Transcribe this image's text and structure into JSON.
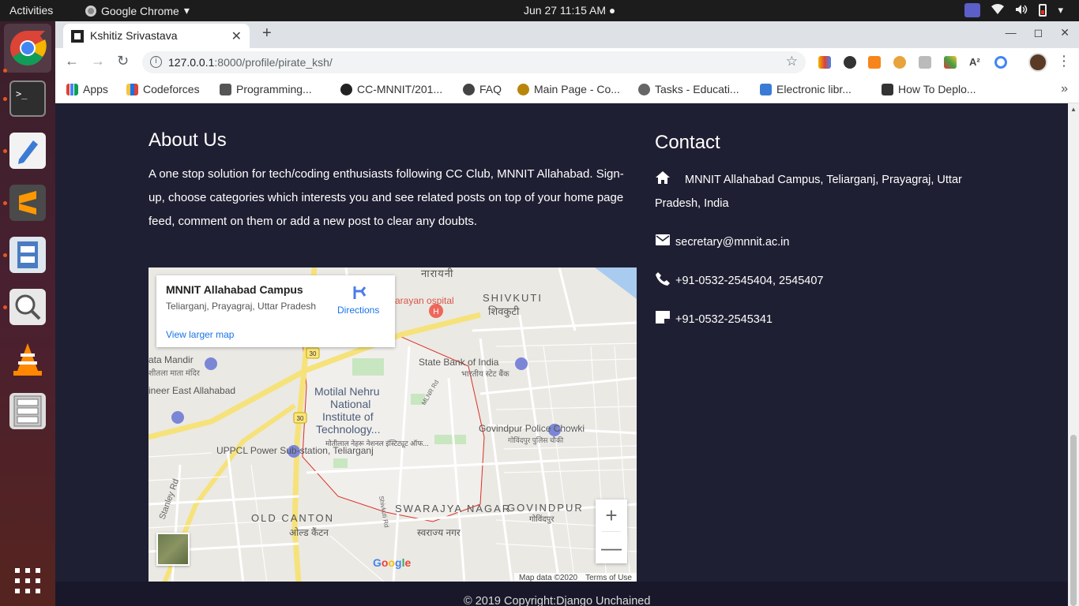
{
  "topbar": {
    "activities": "Activities",
    "app_name": "Google Chrome",
    "app_arrow": "▾",
    "clock": "Jun 27  11:15 AM ●"
  },
  "dock": {
    "items": [
      "chrome",
      "terminal",
      "text-editor",
      "sublime-text",
      "file-manager",
      "search",
      "vlc",
      "file-cabinet",
      "app-grid"
    ]
  },
  "browser": {
    "tab_title": "Kshitiz Srivastava",
    "tab_close": "✕",
    "new_tab": "+",
    "window_controls": [
      "—",
      "◻",
      "✕"
    ],
    "url_host": "127.0.0.1",
    "url_path": ":8000/profile/pirate_ksh/",
    "bookmarks": [
      {
        "label": "Apps",
        "color": "#4285f4"
      },
      {
        "label": "Codeforces",
        "color": "#f6c343"
      },
      {
        "label": "Programming...",
        "color": "#555555"
      },
      {
        "label": "CC-MNNIT/201...",
        "color": "#222222"
      },
      {
        "label": "FAQ",
        "color": "#444444"
      },
      {
        "label": "Main Page - Co...",
        "color": "#b8860b"
      },
      {
        "label": "Tasks - Educati...",
        "color": "#666666"
      },
      {
        "label": "Electronic libr...",
        "color": "#3a7bd5"
      },
      {
        "label": "How To Deplo...",
        "color": "#333333"
      }
    ],
    "bookmarks_more": "»"
  },
  "page": {
    "about_heading": "About Us",
    "about_text": "A one stop solution for tech/coding enthusiasts following CC Club, MNNIT Allahabad. Sign-up, choose categories which interests you and see related posts on top of your home page feed, comment on them or add a new post to clear any doubts.",
    "contact_heading": "Contact",
    "contact": {
      "address": "MNNIT Allahabad Campus, Teliarganj, Prayagraj, Uttar Pradesh, India",
      "email": "secretary@mnnit.ac.in",
      "phone": "+91-0532-2545404, 2545407",
      "fax": "+91-0532-2545341"
    },
    "map": {
      "place_name": "MNNIT Allahabad Campus",
      "place_address": "Teliarganj, Prayagraj, Uttar Pradesh",
      "directions": "Directions",
      "larger_map": "View larger map",
      "zoom_in": "+",
      "zoom_out": "—",
      "attribution_data": "Map data ©2020",
      "terms": "Terms of Use",
      "labels": {
        "shivkuti": "SHIVKUTI",
        "shivkuti_hi": "शिवकुटी",
        "narayani": "नारायनी",
        "hospital": "arayan ospital",
        "sbi": "State Bank of India",
        "sbi_hi": "भारतीय स्टेट बैंक",
        "mandir": "ata Mandir",
        "mandir_hi": "शीतला माता मंदिर",
        "engineer": "ineer East Allahabad",
        "mnnit1": "Motilal Nehru",
        "mnnit2": "National",
        "mnnit3": "Institute of",
        "mnnit4": "Technology...",
        "mnnit_hi": "मोतीलाल नेहरू नेशनल इंस्टिट्यूट ऑफ...",
        "govindpur_pc": "Govindpur Police Chowki",
        "govindpur_pc_hi": "गोविंदपुर पुलिस चौकी",
        "uppcl": "UPPCL Power Sub-station, Teliarganj",
        "stanley": "Stanley Rd",
        "old_canton": "OLD CANTON",
        "old_canton_hi": "ओल्ड कैंटन",
        "swarajya": "SWARAJYA NAGAR",
        "swarajya_hi": "स्वराज्य नगर",
        "govindpur": "GOVINDPUR",
        "govindpur_hi": "गोविंदपुर",
        "mlnr": "MLNR Rd",
        "shivkuti_rd": "Shivkuti Rd",
        "route30": "30",
        "google": "Google"
      }
    },
    "footer": "© 2019 Copyright:Django Unchained"
  }
}
